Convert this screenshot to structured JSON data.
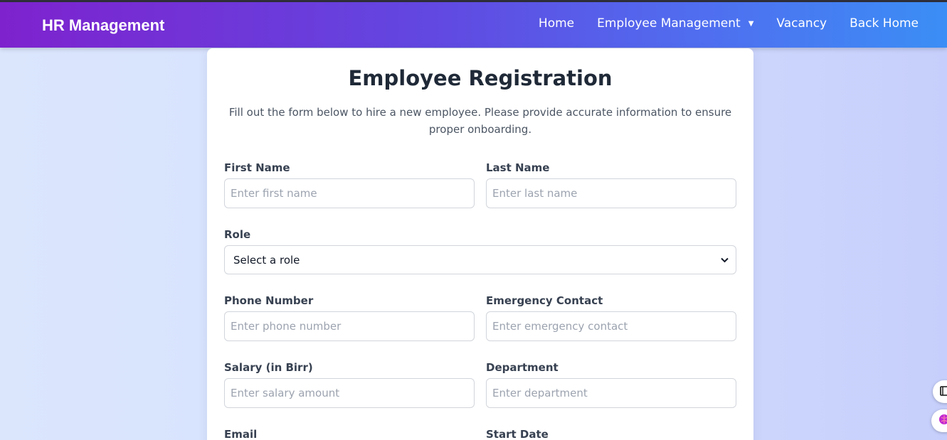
{
  "navbar": {
    "brand": "HR Management",
    "links": [
      {
        "label": "Home"
      },
      {
        "label": "Employee Management",
        "caret": "▼"
      },
      {
        "label": "Vacancy"
      },
      {
        "label": "Back Home"
      }
    ]
  },
  "form": {
    "title": "Employee Registration",
    "subtitle": "Fill out the form below to hire a new employee. Please provide accurate information to ensure proper onboarding.",
    "first_name": {
      "label": "First Name",
      "placeholder": "Enter first name"
    },
    "last_name": {
      "label": "Last Name",
      "placeholder": "Enter last name"
    },
    "role": {
      "label": "Role",
      "value": "Select a role"
    },
    "phone": {
      "label": "Phone Number",
      "placeholder": "Enter phone number"
    },
    "emergency": {
      "label": "Emergency Contact",
      "placeholder": "Enter emergency contact"
    },
    "salary": {
      "label": "Salary (in Birr)",
      "placeholder": "Enter salary amount"
    },
    "department": {
      "label": "Department",
      "placeholder": "Enter department"
    },
    "email": {
      "label": "Email"
    },
    "start_date": {
      "label": "Start Date"
    }
  },
  "floating_buttons": [
    {
      "icon": "book-icon"
    },
    {
      "icon": "brain-icon"
    }
  ],
  "colors": {
    "nav_gradient_start": "#7e22ce",
    "nav_gradient_end": "#3b8ef5",
    "title_color": "#1f2937"
  }
}
